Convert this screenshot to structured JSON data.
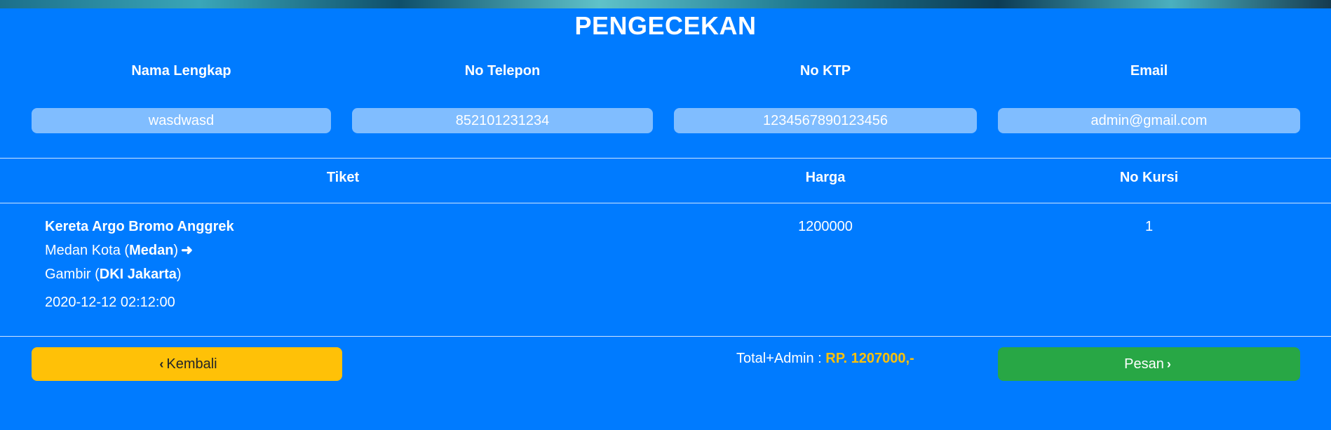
{
  "title": "PENGECEKAN",
  "form": {
    "labels": [
      "Nama Lengkap",
      "No Telepon",
      "No KTP",
      "Email"
    ],
    "values": [
      "wasdwasd",
      "852101231234",
      "1234567890123456",
      "admin@gmail.com"
    ]
  },
  "table": {
    "headers": [
      "Tiket",
      "Harga",
      "No Kursi"
    ],
    "ticket": {
      "name": "Kereta Argo Bromo Anggrek",
      "origin_station": "Medan Kota",
      "origin_city": "Medan",
      "dest_station": "Gambir",
      "dest_city": "DKI Jakarta",
      "datetime": "2020-12-12 02:12:00"
    },
    "price": "1200000",
    "seat": "1"
  },
  "actions": {
    "back_label": "Kembali",
    "order_label": "Pesan",
    "total_label": "Total+Admin :",
    "total_amount": "RP. 1207000,-"
  },
  "icons": {
    "back": "chevron-left-icon",
    "order": "chevron-right-icon",
    "route": "arrow-right-icon"
  },
  "colors": {
    "background": "#007bff",
    "input_bg": "#80bdff",
    "back_button": "#ffc107",
    "order_button": "#28a745",
    "total_amount": "#ffc107"
  }
}
